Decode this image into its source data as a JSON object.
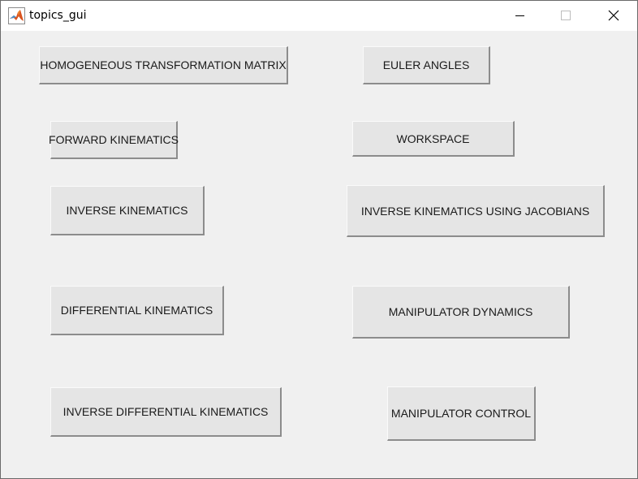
{
  "window": {
    "title": "topics_gui"
  },
  "buttons": {
    "homogeneous_transformation_matrix": "HOMOGENEOUS TRANSFORMATION MATRIX",
    "euler_angles": "EULER ANGLES",
    "forward_kinematics": "FORWARD KINEMATICS",
    "workspace": "WORKSPACE",
    "inverse_kinematics": "INVERSE KINEMATICS",
    "inverse_kinematics_using_jacobians": "INVERSE KINEMATICS USING JACOBIANS",
    "differential_kinematics": "DIFFERENTIAL KINEMATICS",
    "manipulator_dynamics": "MANIPULATOR DYNAMICS",
    "inverse_differential_kinematics": "INVERSE DIFFERENTIAL KINEMATICS",
    "manipulator_control": "MANIPULATOR CONTROL"
  },
  "icons": {
    "app": "matlab-logo-icon",
    "minimize": "minimize-icon",
    "maximize": "maximize-icon",
    "close": "close-icon"
  }
}
